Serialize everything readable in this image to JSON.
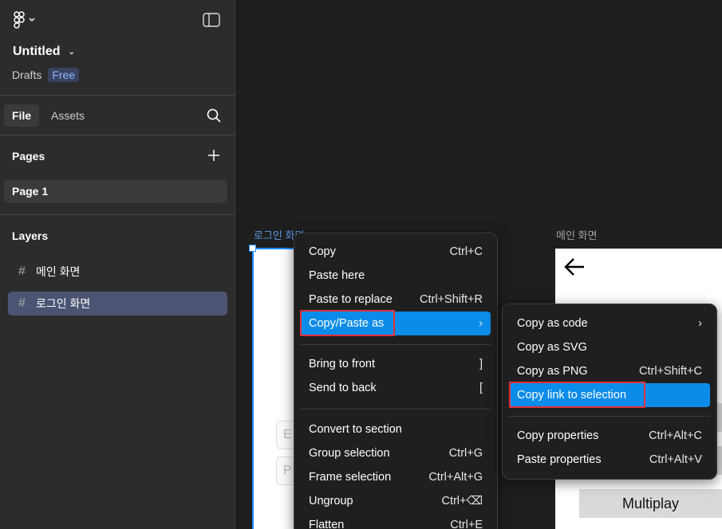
{
  "sidebar": {
    "file_title": "Untitled",
    "drafts_label": "Drafts",
    "plan_badge": "Free",
    "tabs": [
      {
        "label": "File"
      },
      {
        "label": "Assets"
      }
    ],
    "pages_heading": "Pages",
    "pages": [
      {
        "label": "Page 1"
      }
    ],
    "layers_heading": "Layers",
    "layers": [
      {
        "label": "메인 화면"
      },
      {
        "label": "로그인 화면"
      }
    ]
  },
  "canvas": {
    "frame_labels": [
      "로그인 화면",
      "메인 화면"
    ],
    "field_hints": [
      "E",
      "P"
    ],
    "multiplay_label": "Multiplay"
  },
  "context_menu": {
    "items": [
      {
        "label": "Copy",
        "shortcut": "Ctrl+C"
      },
      {
        "label": "Paste here",
        "shortcut": ""
      },
      {
        "label": "Paste to replace",
        "shortcut": "Ctrl+Shift+R"
      },
      {
        "label": "Copy/Paste as",
        "shortcut": "›"
      },
      {
        "label": "Bring to front",
        "shortcut": "]"
      },
      {
        "label": "Send to back",
        "shortcut": "["
      },
      {
        "label": "Convert to section",
        "shortcut": ""
      },
      {
        "label": "Group selection",
        "shortcut": "Ctrl+G"
      },
      {
        "label": "Frame selection",
        "shortcut": "Ctrl+Alt+G"
      },
      {
        "label": "Ungroup",
        "shortcut": "Ctrl+⌫"
      },
      {
        "label": "Flatten",
        "shortcut": "Ctrl+E"
      }
    ]
  },
  "submenu": {
    "items": [
      {
        "label": "Copy as code",
        "shortcut": "›"
      },
      {
        "label": "Copy as SVG",
        "shortcut": ""
      },
      {
        "label": "Copy as PNG",
        "shortcut": "Ctrl+Shift+C"
      },
      {
        "label": "Copy link to selection",
        "shortcut": ""
      },
      {
        "label": "Copy properties",
        "shortcut": "Ctrl+Alt+C"
      },
      {
        "label": "Paste properties",
        "shortcut": "Ctrl+Alt+V"
      }
    ]
  },
  "colors": {
    "highlight": "#0c8ce9",
    "annotation": "#e0303a",
    "selection": "#1a8cff"
  }
}
